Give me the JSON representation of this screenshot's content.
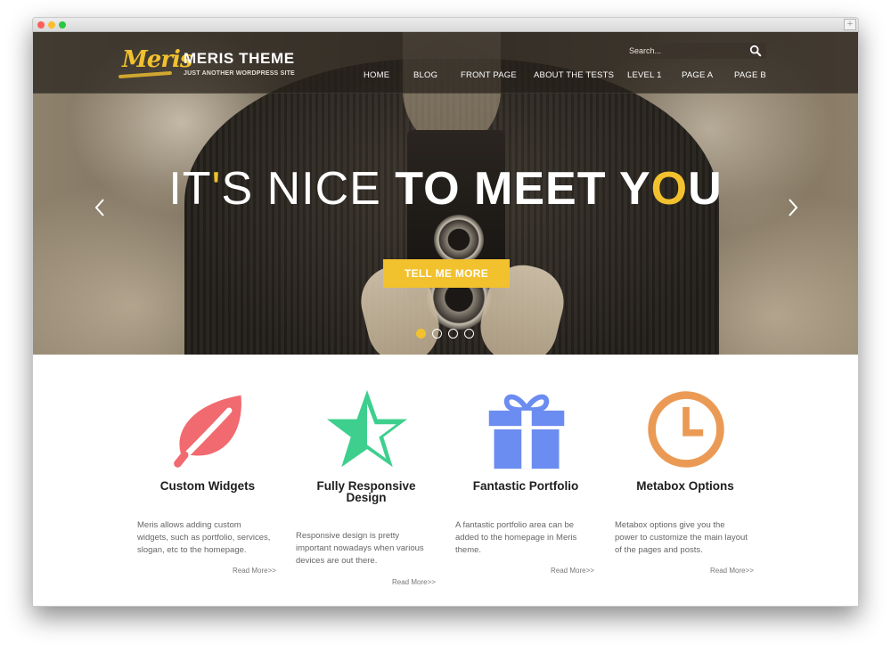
{
  "browser": {
    "expand_glyph": "+"
  },
  "site": {
    "logo_text": "Meris",
    "title": "MERIS THEME",
    "tagline": "JUST ANOTHER WORDPRESS SITE",
    "search_placeholder": "Search...",
    "accent_color": "#f2c12e"
  },
  "nav": {
    "items": [
      {
        "label": "HOME"
      },
      {
        "label": "BLOG"
      },
      {
        "label": "FRONT PAGE"
      },
      {
        "label": "ABOUT THE TESTS"
      },
      {
        "label": "LEVEL 1"
      },
      {
        "label": "PAGE A"
      },
      {
        "label": "PAGE B"
      }
    ]
  },
  "hero": {
    "headline_light_1": "IT",
    "headline_accent_1": "'",
    "headline_light_2": "S NICE ",
    "headline_bold_1": "TO MEET Y",
    "headline_accent_2": "O",
    "headline_bold_2": "U",
    "cta_label": "TELL ME MORE",
    "slide_count": 4,
    "active_slide": 1,
    "prev_icon": "chevron-left",
    "next_icon": "chevron-right"
  },
  "features": [
    {
      "title": "Custom Widgets",
      "text_lines": [
        "Meris allows adding custom",
        "widgets, such as portfolio, services,",
        "slogan, etc to the homepage."
      ],
      "link": "Read More>>",
      "icon": "leaf-icon",
      "icon_color": "#f16a6f"
    },
    {
      "title_lines": [
        "Fully Responsive",
        "Design"
      ],
      "text_lines": [
        "Responsive design is pretty",
        "important nowadays when various",
        "devices are out there."
      ],
      "link": "Read More>>",
      "icon": "star-icon",
      "icon_color": "#3ecf8e"
    },
    {
      "title": "Fantastic Portfolio",
      "text_lines": [
        "A fantastic portfolio area can be",
        "added to the homepage in Meris",
        "theme."
      ],
      "link": "Read More>>",
      "icon": "gift-icon",
      "icon_color": "#6b8cf0"
    },
    {
      "title": "Metabox Options",
      "text_lines": [
        "Metabox options give you the",
        "power to customize the main layout",
        "of the pages and posts."
      ],
      "link": "Read More>>",
      "icon": "clock-icon",
      "icon_color": "#eb9a55"
    }
  ]
}
